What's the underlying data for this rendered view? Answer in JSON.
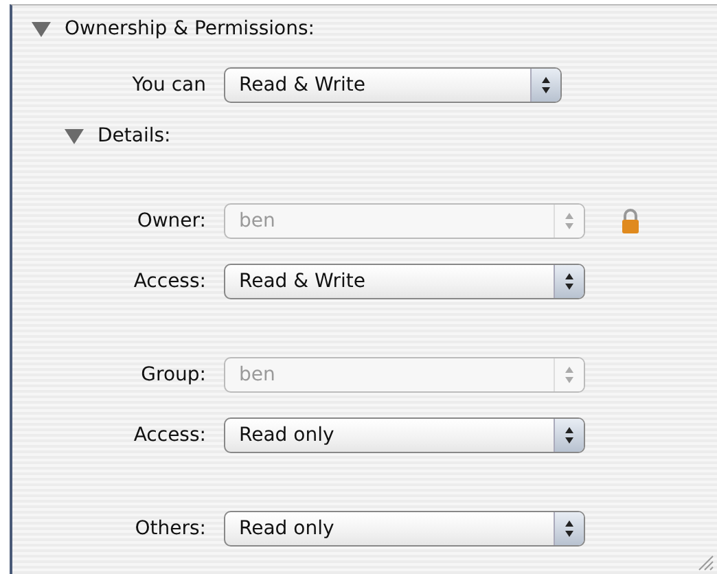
{
  "section": {
    "title": "Ownership & Permissions:",
    "expanded": true,
    "you_can": {
      "label": "You can",
      "value": "Read & Write",
      "disabled": false
    },
    "details": {
      "title": "Details:",
      "expanded": true,
      "groups": [
        [
          {
            "label": "Owner:",
            "value": "ben",
            "disabled": true,
            "locked": true
          },
          {
            "label": "Access:",
            "value": "Read & Write",
            "disabled": false,
            "locked": false
          }
        ],
        [
          {
            "label": "Group:",
            "value": "ben",
            "disabled": true,
            "locked": false
          },
          {
            "label": "Access:",
            "value": "Read only",
            "disabled": false,
            "locked": false
          }
        ],
        [
          {
            "label": "Others:",
            "value": "Read only",
            "disabled": false,
            "locked": false
          }
        ]
      ]
    }
  }
}
